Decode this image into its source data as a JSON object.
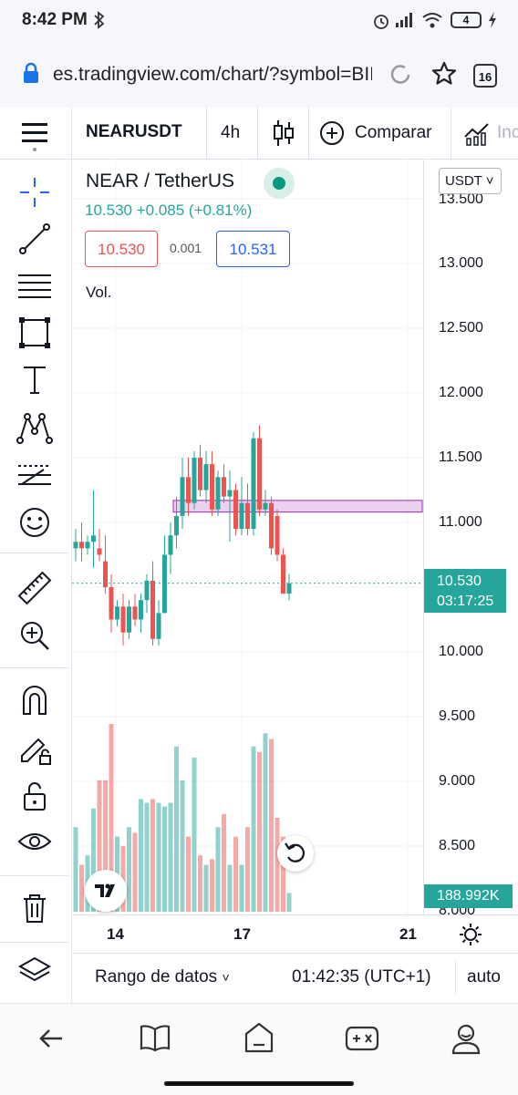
{
  "status_bar": {
    "time": "8:42 PM",
    "battery": "4"
  },
  "browser": {
    "url": "es.tradingview.com/chart/?symbol=BIN",
    "tab_count": "16"
  },
  "toolbar": {
    "symbol": "NEARUSDT",
    "interval": "4h",
    "compare_label": "Comparar",
    "indicators_label": "Inc"
  },
  "legend": {
    "title": "NEAR / TetherUS",
    "change": "10.530  +0.085 (+0.81%)",
    "sell_price": "10.530",
    "spread": "0.001",
    "buy_price": "10.531",
    "volume_label": "Vol."
  },
  "price_axis": {
    "currency": "USDT",
    "ticks": [
      "13.500",
      "13.000",
      "12.500",
      "12.000",
      "11.500",
      "11.000",
      "10.530",
      "10.000",
      "9.500",
      "9.000",
      "8.500",
      "8.000"
    ],
    "last_price": "10.530",
    "countdown": "03:17:25",
    "last_volume": "188.992K"
  },
  "time_axis": {
    "labels": [
      "14",
      "17",
      "21"
    ]
  },
  "bottom_bar": {
    "range_label": "Rango de datos",
    "clock": "01:42:35 (UTC+1)",
    "scale_mode": "auto"
  },
  "colors": {
    "up": "#26a69a",
    "down": "#ef5350",
    "zone_fill": "#e1bee7",
    "zone_stroke": "#9c27b0"
  },
  "chart_data": {
    "type": "candlestick",
    "symbol": "NEAR / TetherUS",
    "interval": "4h",
    "ylim": [
      8.0,
      13.6
    ],
    "candles": [
      {
        "o": 10.8,
        "h": 10.95,
        "l": 10.7,
        "c": 10.85,
        "v": 0.45
      },
      {
        "o": 10.85,
        "h": 11.0,
        "l": 10.7,
        "c": 10.8,
        "v": 0.25
      },
      {
        "o": 10.8,
        "h": 10.9,
        "l": 10.75,
        "c": 10.85,
        "v": 0.3
      },
      {
        "o": 10.85,
        "h": 11.25,
        "l": 10.65,
        "c": 10.9,
        "v": 0.55
      },
      {
        "o": 10.8,
        "h": 10.95,
        "l": 10.7,
        "c": 10.75,
        "v": 0.7
      },
      {
        "o": 10.7,
        "h": 10.9,
        "l": 10.45,
        "c": 10.5,
        "v": 0.7
      },
      {
        "o": 10.5,
        "h": 10.6,
        "l": 10.15,
        "c": 10.25,
        "v": 1.0
      },
      {
        "o": 10.25,
        "h": 10.4,
        "l": 10.2,
        "c": 10.35,
        "v": 0.4
      },
      {
        "o": 10.35,
        "h": 10.45,
        "l": 10.05,
        "c": 10.15,
        "v": 0.35
      },
      {
        "o": 10.15,
        "h": 10.4,
        "l": 10.1,
        "c": 10.35,
        "v": 0.45
      },
      {
        "o": 10.35,
        "h": 10.45,
        "l": 10.2,
        "c": 10.25,
        "v": 0.42
      },
      {
        "o": 10.25,
        "h": 10.45,
        "l": 10.15,
        "c": 10.4,
        "v": 0.6
      },
      {
        "o": 10.4,
        "h": 10.6,
        "l": 10.3,
        "c": 10.55,
        "v": 0.58
      },
      {
        "o": 10.55,
        "h": 10.7,
        "l": 10.05,
        "c": 10.1,
        "v": 0.6
      },
      {
        "o": 10.1,
        "h": 10.4,
        "l": 10.05,
        "c": 10.3,
        "v": 0.58
      },
      {
        "o": 10.3,
        "h": 10.9,
        "l": 10.3,
        "c": 10.75,
        "v": 0.56
      },
      {
        "o": 10.75,
        "h": 11.0,
        "l": 10.6,
        "c": 10.9,
        "v": 0.58
      },
      {
        "o": 10.9,
        "h": 11.2,
        "l": 10.8,
        "c": 11.05,
        "v": 0.88
      },
      {
        "o": 11.05,
        "h": 11.5,
        "l": 10.95,
        "c": 11.35,
        "v": 0.7
      },
      {
        "o": 11.35,
        "h": 11.5,
        "l": 11.05,
        "c": 11.15,
        "v": 0.4
      },
      {
        "o": 11.15,
        "h": 11.55,
        "l": 11.1,
        "c": 11.5,
        "v": 0.82
      },
      {
        "o": 11.5,
        "h": 11.6,
        "l": 11.2,
        "c": 11.25,
        "v": 0.3
      },
      {
        "o": 11.25,
        "h": 11.55,
        "l": 11.15,
        "c": 11.45,
        "v": 0.25
      },
      {
        "o": 11.45,
        "h": 11.55,
        "l": 11.05,
        "c": 11.1,
        "v": 0.28
      },
      {
        "o": 11.1,
        "h": 11.4,
        "l": 11.05,
        "c": 11.35,
        "v": 0.45
      },
      {
        "o": 11.35,
        "h": 11.45,
        "l": 11.15,
        "c": 11.2,
        "v": 0.52
      },
      {
        "o": 11.2,
        "h": 11.4,
        "l": 10.85,
        "c": 11.25,
        "v": 0.25
      },
      {
        "o": 11.25,
        "h": 11.3,
        "l": 10.9,
        "c": 10.95,
        "v": 0.4
      },
      {
        "o": 10.95,
        "h": 11.35,
        "l": 10.9,
        "c": 11.15,
        "v": 0.25
      },
      {
        "o": 11.15,
        "h": 11.3,
        "l": 10.9,
        "c": 10.95,
        "v": 0.45
      },
      {
        "o": 10.95,
        "h": 11.7,
        "l": 10.9,
        "c": 11.65,
        "v": 0.88
      },
      {
        "o": 11.65,
        "h": 11.75,
        "l": 11.05,
        "c": 11.1,
        "v": 0.85
      },
      {
        "o": 11.1,
        "h": 11.25,
        "l": 11.05,
        "c": 11.15,
        "v": 0.95
      },
      {
        "o": 11.15,
        "h": 11.2,
        "l": 10.75,
        "c": 10.8,
        "v": 0.92
      },
      {
        "o": 11.05,
        "h": 11.1,
        "l": 10.7,
        "c": 10.75,
        "v": 0.5
      },
      {
        "o": 10.75,
        "h": 10.8,
        "l": 10.45,
        "c": 10.45,
        "v": 0.4
      },
      {
        "o": 10.45,
        "h": 10.6,
        "l": 10.4,
        "c": 10.53,
        "v": 0.1
      }
    ],
    "zone": {
      "top": 11.17,
      "bottom": 11.08,
      "from_index": 16
    }
  }
}
